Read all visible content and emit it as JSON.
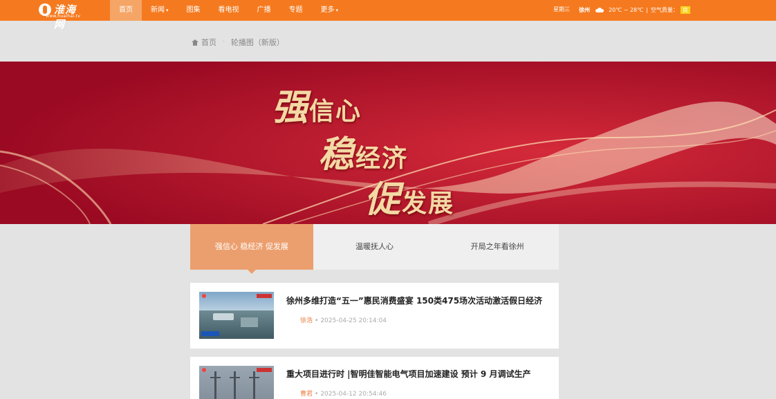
{
  "header": {
    "logo_name": "淮海网",
    "logo_url": "www.huaihai.tv",
    "nav": [
      {
        "label": "首页",
        "active": true
      },
      {
        "label": "新闻",
        "dropdown": true
      },
      {
        "label": "图集"
      },
      {
        "label": "看电视"
      },
      {
        "label": "广播"
      },
      {
        "label": "专题"
      },
      {
        "label": "更多",
        "dropdown": true
      }
    ],
    "weekday": "星期三",
    "weather": {
      "city": "徐州",
      "icon": "cloud-icon",
      "temperature": "20℃ ~ 28℃",
      "divider": "|",
      "air_label": "空气质量：",
      "air_value": "良"
    }
  },
  "breadcrumb": {
    "home": "首页",
    "separator": "·",
    "current": "轮播图（新版）"
  },
  "banner": {
    "line1": "强信心",
    "line2": "稳经济",
    "line3": "促发展"
  },
  "tabs": [
    {
      "label": "强信心 稳经济 促发展",
      "active": true
    },
    {
      "label": "温暖抚人心"
    },
    {
      "label": "开局之年看徐州"
    }
  ],
  "news": [
    {
      "title": "徐州多维打造“五一”惠民消费盛宴 150类475场次活动激活假日经济",
      "author": "徐浩",
      "datetime": "2025-04-25 20:14:04"
    },
    {
      "title": "重大项目进行时 |智明佳智能电气项目加速建设 预计 9 月调试生产",
      "author": "曹君",
      "datetime": "2025-04-12 20:54:46"
    }
  ],
  "colors": {
    "header_bg": "#f57a1f",
    "active_nav": "#f5a566",
    "tab_active": "#ec9f6e",
    "banner_red": "#b0102a",
    "slogan_gold": "#f3d9a4",
    "author": "#e9834a"
  }
}
